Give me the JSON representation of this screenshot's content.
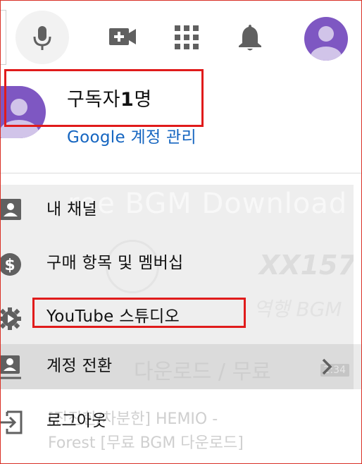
{
  "topbar": {
    "mic_icon": "microphone-icon",
    "create_icon": "video-camera-plus-icon",
    "apps_icon": "apps-grid-icon",
    "notifications_icon": "bell-icon",
    "avatar_icon": "account-avatar"
  },
  "account": {
    "channel_name": "구독자",
    "subscriber_count": "1",
    "subscriber_unit": "명",
    "manage_link": "Google 계정 관리"
  },
  "menu": {
    "items": [
      {
        "label": "내 채널",
        "icon": "account-box-icon"
      },
      {
        "label": "구매 항목 및 멤버십",
        "icon": "dollar-circle-icon"
      },
      {
        "label": "YouTube 스튜디오",
        "icon": "studio-gear-icon"
      },
      {
        "label": "계정 전환",
        "icon": "switch-account-icon"
      },
      {
        "label": "로그아웃",
        "icon": "logout-icon"
      }
    ],
    "chevron_icon": "chevron-right-icon"
  },
  "background": {
    "thumbnail_title": "ree BGM Download",
    "thumbnail_number": "XX157",
    "thumbnail_line": "역행 BGM",
    "thumbnail_bottom": "다운로드 / 무료",
    "duration": "2:34",
    "video_title_line1": "[잔잔한/차분한] HEMIO -",
    "video_title_line2": "Forest [무료 BGM 다운로드]"
  },
  "colors": {
    "avatar": "#7e57c2",
    "link": "#1565c0",
    "highlight": "#e01b1b",
    "icon": "#606060"
  }
}
